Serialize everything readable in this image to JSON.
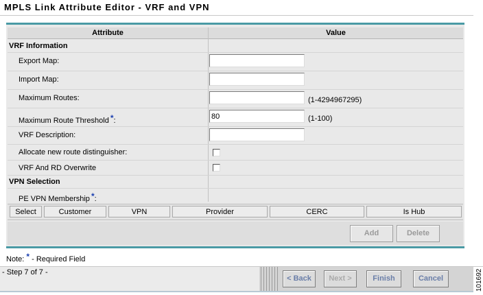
{
  "window": {
    "title": "MPLS Link Attribute Editor - VRF and VPN"
  },
  "table": {
    "header_attribute": "Attribute",
    "header_value": "Value"
  },
  "vrf": {
    "section_title": "VRF Information",
    "export_map_label": "Export Map:",
    "export_map_value": "",
    "import_map_label": "Import Map:",
    "import_map_value": "",
    "max_routes_label": "Maximum Routes:",
    "max_routes_value": "",
    "max_routes_hint": "(1-4294967295)",
    "max_route_threshold_label": "Maximum Route Threshold",
    "max_route_threshold_value": "80",
    "max_route_threshold_hint": "(1-100)",
    "vrf_description_label": "VRF Description:",
    "vrf_description_value": "",
    "allocate_rd_label": "Allocate new route distinguisher:",
    "allocate_rd_checked": false,
    "vrf_rd_overwrite_label": "VRF And RD Overwrite",
    "vrf_rd_overwrite_checked": false
  },
  "vpn": {
    "section_title": "VPN Selection",
    "pe_membership_label": "PE VPN Membership",
    "required_marker": "*",
    "table_columns": [
      "Select",
      "Customer",
      "VPN",
      "Provider",
      "CERC",
      "Is Hub"
    ],
    "add_label": "Add",
    "delete_label": "Delete"
  },
  "note": {
    "prefix": "Note:",
    "marker": "*",
    "text": "- Required Field"
  },
  "footer": {
    "step_text": "- Step 7 of 7 -",
    "back_label": "< Back",
    "next_label": "Next >",
    "finish_label": "Finish",
    "cancel_label": "Cancel",
    "side_tag": "101692"
  },
  "colors": {
    "accent": "#4a9aa5",
    "required": "#1a3fb0",
    "wizard_button_text": "#6a7ea8"
  }
}
